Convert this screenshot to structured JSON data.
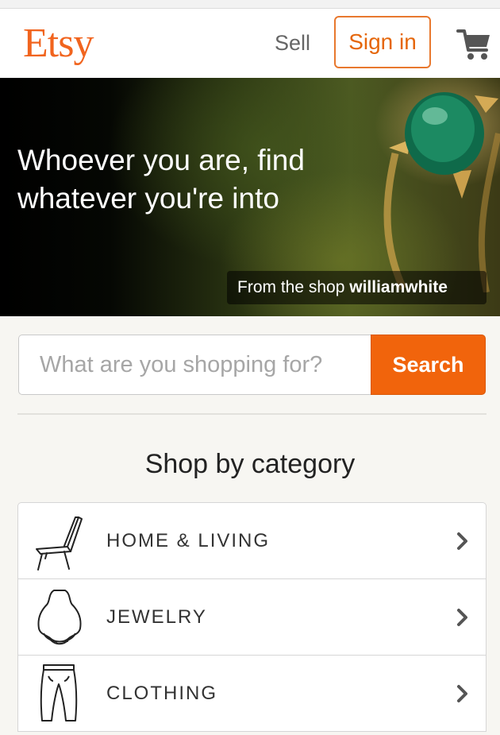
{
  "header": {
    "logo": "Etsy",
    "sell_label": "Sell",
    "signin_label": "Sign in",
    "cart_icon": "cart-icon"
  },
  "hero": {
    "title": "Whoever you are, find whatever you're into",
    "credit_prefix": "From the shop",
    "credit_shop": "williamwhite"
  },
  "search": {
    "placeholder": "What are you shopping for?",
    "button_label": "Search"
  },
  "categories": {
    "title": "Shop by category",
    "items": [
      {
        "label": "HOME & LIVING",
        "icon": "chair-icon"
      },
      {
        "label": "JEWELRY",
        "icon": "necklace-icon"
      },
      {
        "label": "CLOTHING",
        "icon": "pants-icon"
      }
    ]
  },
  "colors": {
    "brand": "#f1641e",
    "search_button": "#f1640c",
    "background": "#f7f6f2"
  }
}
